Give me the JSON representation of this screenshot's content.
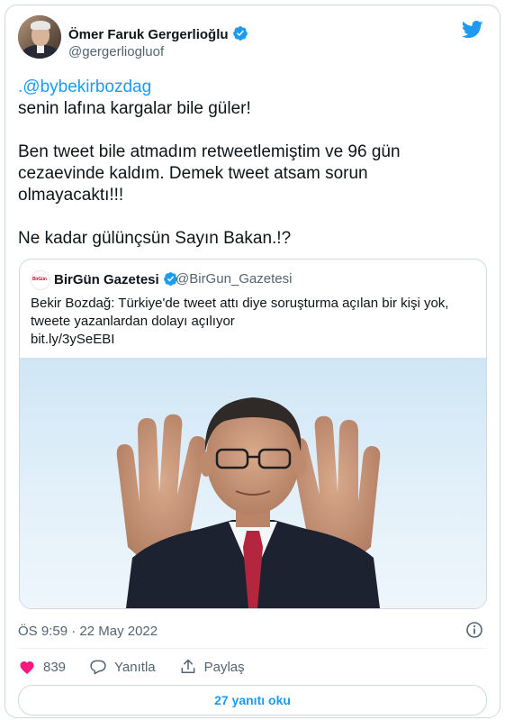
{
  "author": {
    "name": "Ömer Faruk Gergerlioğlu",
    "handle": "@gergerliogluof",
    "verified": true
  },
  "tweet": {
    "lines": [
      [
        {
          "text": ".@bybekirbozdag",
          "mention": true
        }
      ],
      [
        {
          "text": "senin lafına kargalar bile güler!"
        }
      ],
      [],
      [
        {
          "text": "Ben tweet bile atmadım retweetlemiştim ve 96 gün"
        }
      ],
      [
        {
          "text": "cezaevinde kaldım. Demek tweet atsam sorun"
        }
      ],
      [
        {
          "text": "olmayacaktı!!!"
        }
      ],
      [],
      [
        {
          "text": "Ne kadar gülünçsün Sayın Bakan.!?"
        }
      ]
    ]
  },
  "quote": {
    "avatar_logo": "BirGün",
    "name": "BirGün Gazetesi",
    "handle": "@BirGun_Gazetesi",
    "text_lines": [
      "Bekir Bozdağ: Türkiye'de tweet attı diye soruşturma açılan bir kişi yok,",
      "tweete yazanlardan dolayı açılıyor",
      "bit.ly/3ySeEBI"
    ]
  },
  "meta": {
    "time": "ÖS 9:59",
    "separator": "·",
    "date": "22 May 2022"
  },
  "actions": {
    "likes": "839",
    "reply_label": "Yanıtla",
    "share_label": "Paylaş"
  },
  "replies_button": "27 yanıtı oku",
  "colors": {
    "accent": "#1d9bf0",
    "text": "#0f1419",
    "secondary": "#536471",
    "border": "#cfd9de",
    "like_red": "#f91880"
  },
  "icons": {
    "logo": "twitter-bird-icon",
    "badge": "verified-badge-icon",
    "info": "info-icon",
    "like": "heart-icon",
    "reply": "speech-bubble-icon",
    "share": "share-upload-icon"
  }
}
